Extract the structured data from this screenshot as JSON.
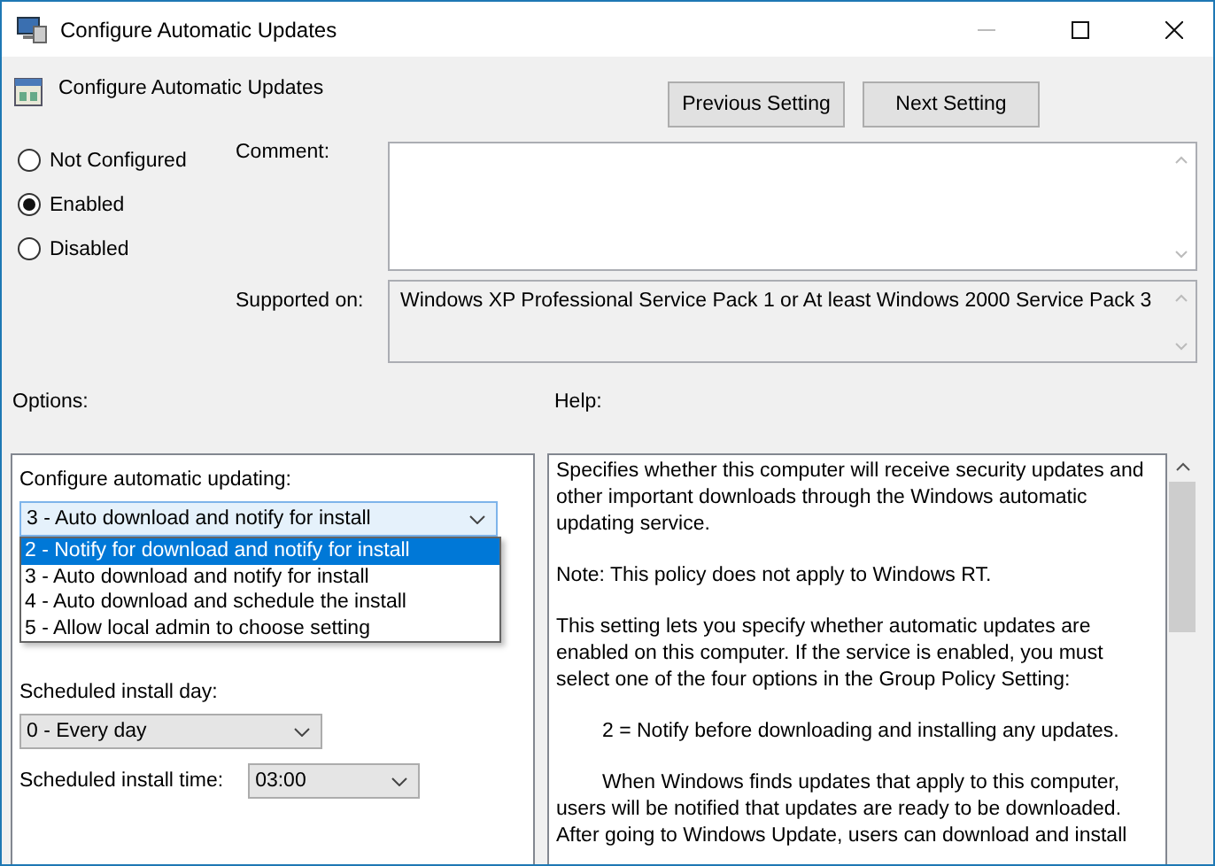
{
  "window": {
    "title": "Configure Automatic Updates"
  },
  "header": {
    "title": "Configure Automatic Updates",
    "buttons": [
      "Previous Setting",
      "Next Setting"
    ]
  },
  "state_options": [
    {
      "label": "Not Configured",
      "selected": false
    },
    {
      "label": "Enabled",
      "selected": true
    },
    {
      "label": "Disabled",
      "selected": false
    }
  ],
  "comment": {
    "label": "Comment:"
  },
  "supported_on": {
    "label": "Supported on:",
    "value": "Windows XP Professional Service Pack 1 or At least Windows 2000 Service Pack 3"
  },
  "options": {
    "label": "Options:",
    "update_label": "Configure automatic updating:",
    "update_value": "3 - Auto download and notify for install",
    "expanded": true,
    "update_choices": [
      {
        "label": "2 - Notify for download and notify for install",
        "selected": true
      },
      {
        "label": "3 - Auto download and notify for install",
        "selected": false
      },
      {
        "label": "4 - Auto download and schedule the install",
        "selected": false
      },
      {
        "label": "5 - Allow local admin to choose setting",
        "selected": false
      }
    ],
    "day_label": "Scheduled install day:",
    "day_value": "0 - Every day",
    "time_label": "Scheduled install time:",
    "time_value": "03:00"
  },
  "help": {
    "label": "Help:",
    "paragraphs": [
      {
        "text": "Specifies whether this computer will receive security updates and other important downloads through the Windows automatic updating service.",
        "indent": false
      },
      {
        "text": "Note: This policy does not apply to Windows RT.",
        "indent": false
      },
      {
        "text": "This setting lets you specify whether automatic updates are enabled on this computer. If the service is enabled, you must select one of the four options in the Group Policy Setting:",
        "indent": false
      },
      {
        "text": "2 = Notify before downloading and installing any updates.",
        "indent": true
      },
      {
        "text": "When Windows finds updates that apply to this computer, users will be notified that updates are ready to be downloaded. After going to Windows Update, users can download and install",
        "indent": true
      }
    ]
  }
}
